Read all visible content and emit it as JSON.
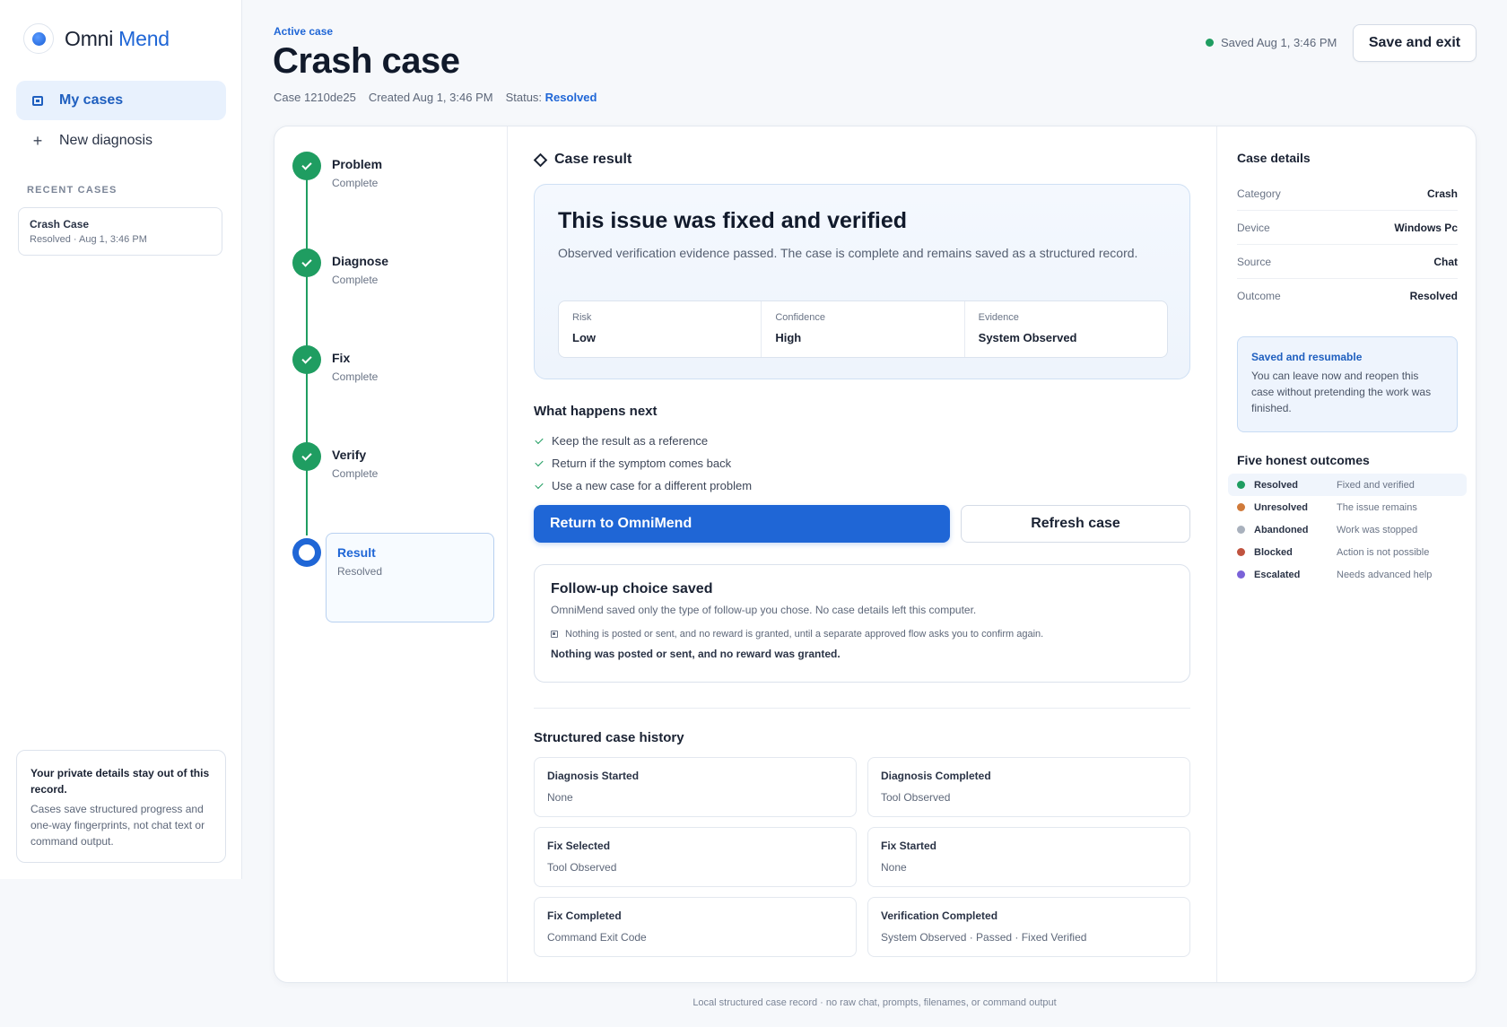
{
  "app": {
    "brand_1": "Omni",
    "brand_2": "Mend"
  },
  "sidebar": {
    "nav": [
      {
        "label": "My cases",
        "icon": "folder-icon"
      },
      {
        "label": "New diagnosis",
        "icon": "plus-icon"
      }
    ],
    "recent_label": "RECENT CASES",
    "recent": [
      {
        "title": "Crash Case",
        "meta": "Resolved · Aug 1, 3:46 PM"
      }
    ],
    "privacy": {
      "title": "Your private details stay out of this record.",
      "body": "Cases save structured progress and one-way fingerprints, not chat text or command output."
    }
  },
  "header": {
    "eyebrow": "Active case",
    "title": "Crash case",
    "case_id": "Case 1210de25",
    "created": "Created Aug 1, 3:46 PM",
    "status_label": "Status:",
    "status_value": "Resolved",
    "saved": "Saved Aug 1, 3:46 PM",
    "save_exit": "Save and exit"
  },
  "steps": [
    {
      "label": "Problem",
      "sub": "Complete"
    },
    {
      "label": "Diagnose",
      "sub": "Complete"
    },
    {
      "label": "Fix",
      "sub": "Complete"
    },
    {
      "label": "Verify",
      "sub": "Complete"
    },
    {
      "label": "Result",
      "sub": "Resolved"
    }
  ],
  "result": {
    "section": "Case result",
    "title": "This issue was fixed and verified",
    "desc": "Observed verification evidence passed. The case is complete and remains saved as a structured record.",
    "metrics": [
      {
        "k": "Risk",
        "v": "Low"
      },
      {
        "k": "Confidence",
        "v": "High"
      },
      {
        "k": "Evidence",
        "v": "System Observed"
      }
    ]
  },
  "next": {
    "head": "What happens next",
    "items": [
      "Keep the result as a reference",
      "Return if the symptom comes back",
      "Use a new case for a different problem"
    ],
    "primary": "Return to OmniMend",
    "secondary": "Refresh case"
  },
  "followup": {
    "title": "Follow-up choice saved",
    "desc": "OmniMend saved only the type of follow-up you chose. No case details left this computer.",
    "note": "Nothing is posted or sent, and no reward is granted, until a separate approved flow asks you to confirm again.",
    "strong": "Nothing was posted or sent, and no reward was granted."
  },
  "history": {
    "head": "Structured case history",
    "items": [
      {
        "title": "Diagnosis Started",
        "val": "None"
      },
      {
        "title": "Diagnosis Completed",
        "val": "Tool Observed"
      },
      {
        "title": "Fix Selected",
        "val": "Tool Observed"
      },
      {
        "title": "Fix Started",
        "val": "None"
      },
      {
        "title": "Fix Completed",
        "val": "Command Exit Code"
      },
      {
        "title": "Verification Completed",
        "val": "System Observed · Passed · Fixed Verified"
      }
    ]
  },
  "details": {
    "head": "Case details",
    "rows": [
      {
        "k": "Category",
        "v": "Crash"
      },
      {
        "k": "Device",
        "v": "Windows Pc"
      },
      {
        "k": "Source",
        "v": "Chat"
      },
      {
        "k": "Outcome",
        "v": "Resolved"
      }
    ],
    "resume_title": "Saved and resumable",
    "resume_body": "You can leave now and reopen this case without pretending the work was finished."
  },
  "outcomes": {
    "head": "Five honest outcomes",
    "items": [
      {
        "name": "Resolved",
        "desc": "Fixed and verified",
        "color": "#1f9d61"
      },
      {
        "name": "Unresolved",
        "desc": "The issue remains",
        "color": "#d07a3a"
      },
      {
        "name": "Abandoned",
        "desc": "Work was stopped",
        "color": "#a9b1bd"
      },
      {
        "name": "Blocked",
        "desc": "Action is not possible",
        "color": "#c0533f"
      },
      {
        "name": "Escalated",
        "desc": "Needs advanced help",
        "color": "#7a62d8"
      }
    ]
  },
  "footer": "Local structured case record · no raw chat, prompts, filenames, or command output"
}
